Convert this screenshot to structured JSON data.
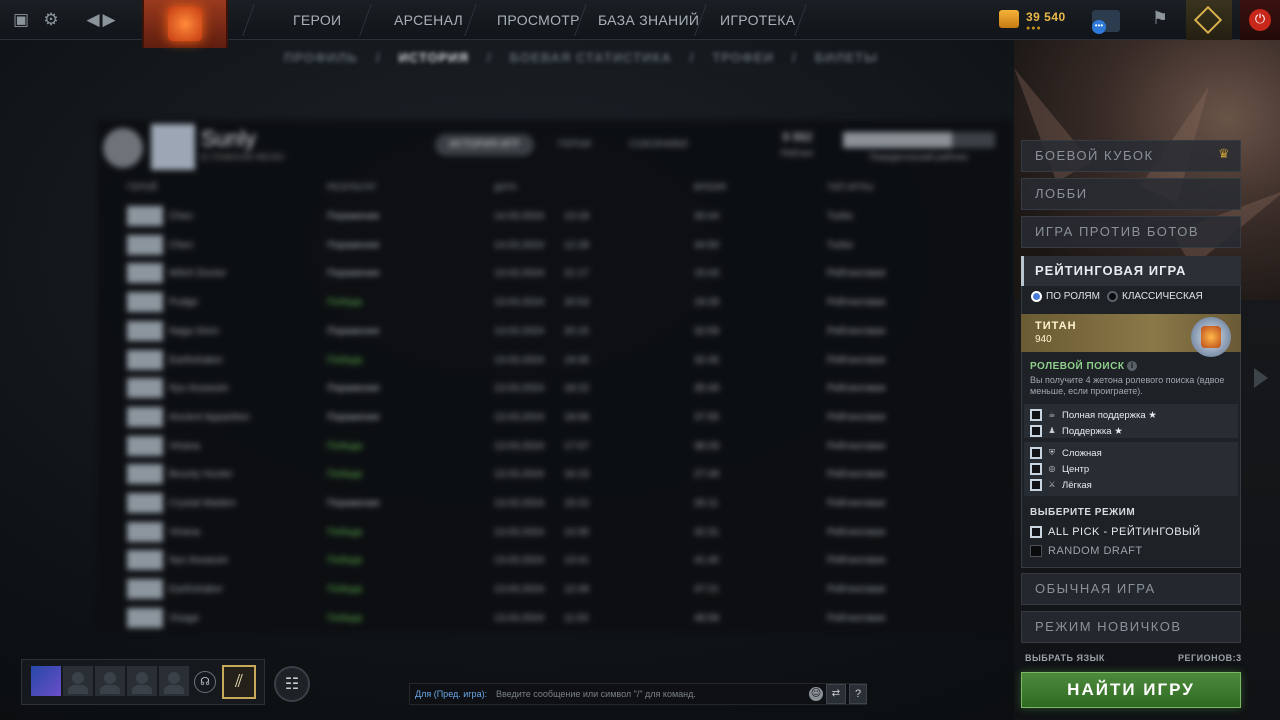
{
  "nav": {
    "items": [
      "ГЕРОИ",
      "АРСЕНАЛ",
      "ПРОСМОТР",
      "БАЗА ЗНАНИЙ",
      "ИГРОТЕКА"
    ],
    "gold": "39 540",
    "gold_dots": "●●●",
    "chat_badge": "•••"
  },
  "profile": {
    "subnav": [
      "ПРОФИЛЬ",
      "ИСТОРИЯ",
      "БОЕВАЯ СТАТИСТИКА",
      "ТРОФЕИ",
      "БИЛЕТЫ"
    ],
    "active_subnav": "ИСТОРИЯ",
    "name": "Sunly",
    "status": "В ГЛАВНОМ МЕНЮ",
    "tabs": [
      "ИСТОРИЯ ИГР",
      "ГЕРОИ",
      "СОЮЗНИКИ"
    ],
    "stat_value": "9 992",
    "stat_label": "Рейтинг",
    "bar_label": "Поведенческий рейтинг",
    "bar_fill": 0.72,
    "columns": [
      "ГЕРОЙ",
      "РЕЗУЛЬТАТ",
      "ДАТА",
      "ВРЕМЯ",
      "ТИП ИГРЫ"
    ],
    "rows": [
      {
        "hero": "Chen",
        "result": "Поражение",
        "win": false,
        "date": "14.03.2024",
        "time": "13:18",
        "duration": "33:44",
        "type": "Turbo"
      },
      {
        "hero": "Chen",
        "result": "Поражение",
        "win": false,
        "date": "14.03.2024",
        "time": "12:28",
        "duration": "34:50",
        "type": "Turbo"
      },
      {
        "hero": "Witch Doctor",
        "result": "Поражение",
        "win": false,
        "date": "13.03.2024",
        "time": "21:17",
        "duration": "15:43",
        "type": "Рейтинговая"
      },
      {
        "hero": "Pudge",
        "result": "Победа",
        "win": true,
        "date": "13.03.2024",
        "time": "20:53",
        "duration": "19:28",
        "type": "Рейтинговая"
      },
      {
        "hero": "Naga Siren",
        "result": "Поражение",
        "win": false,
        "date": "13.03.2024",
        "time": "20:15",
        "duration": "32:59",
        "type": "Рейтинговая"
      },
      {
        "hero": "Earthshaker",
        "result": "Победа",
        "win": true,
        "date": "13.03.2024",
        "time": "19:35",
        "duration": "32:45",
        "type": "Рейтинговая"
      },
      {
        "hero": "Nyx Assassin",
        "result": "Поражение",
        "win": false,
        "date": "13.03.2024",
        "time": "18:22",
        "duration": "35:49",
        "type": "Рейтинговая"
      },
      {
        "hero": "Ancient Apparition",
        "result": "Поражение",
        "win": false,
        "date": "13.03.2024",
        "time": "18:06",
        "duration": "37:55",
        "type": "Рейтинговая"
      },
      {
        "hero": "Viriana",
        "result": "Победа",
        "win": true,
        "date": "13.03.2024",
        "time": "17:07",
        "duration": "38:29",
        "type": "Рейтинговая"
      },
      {
        "hero": "Bounty Hunter",
        "result": "Победа",
        "win": true,
        "date": "13.03.2024",
        "time": "16:15",
        "duration": "27:49",
        "type": "Рейтинговая"
      },
      {
        "hero": "Crystal Maiden",
        "result": "Поражение",
        "win": false,
        "date": "13.03.2024",
        "time": "15:22",
        "duration": "26:11",
        "type": "Рейтинговая"
      },
      {
        "hero": "Viriana",
        "result": "Победа",
        "win": true,
        "date": "13.03.2024",
        "time": "14:30",
        "duration": "42:31",
        "type": "Рейтинговая"
      },
      {
        "hero": "Nyx Assassin",
        "result": "Победа",
        "win": true,
        "date": "13.03.2024",
        "time": "13:41",
        "duration": "41:40",
        "type": "Рейтинговая"
      },
      {
        "hero": "Earthshaker",
        "result": "Победа",
        "win": true,
        "date": "13.03.2024",
        "time": "12:49",
        "duration": "47:21",
        "type": "Рейтинговая"
      },
      {
        "hero": "Visage",
        "result": "Победа",
        "win": true,
        "date": "13.03.2024",
        "time": "11:53",
        "duration": "48:58",
        "type": "Рейтинговая"
      }
    ]
  },
  "play": {
    "battle_cup": "БОЕВОЙ КУБОК",
    "lobby": "ЛОББИ",
    "bots": "ИГРА ПРОТИВ БОТОВ",
    "ranked": "РЕЙТИНГОВАЯ ИГРА",
    "radio_roles": "ПО РОЛЯМ",
    "radio_classic": "КЛАССИЧЕСКАЯ",
    "rank_name": "ТИТАН",
    "rank_value": "940",
    "role_search": "РОЛЕВОЙ ПОИСК",
    "role_search_desc": "Вы получите 4 жетона ролевого поиска (вдвое меньше, если проиграете).",
    "roles_support": [
      "Полная поддержка ★",
      "Поддержка ★"
    ],
    "roles_core": [
      "Сложная",
      "Центр",
      "Лёгкая"
    ],
    "mode_title": "ВЫБЕРИТЕ РЕЖИМ",
    "modes": [
      "ALL PICK - РЕЙТИНГОВЫЙ",
      "RANDOM DRAFT"
    ],
    "normal": "ОБЫЧНАЯ ИГРА",
    "newbie": "РЕЖИМ НОВИЧКОВ",
    "lang": "ВЫБРАТЬ ЯЗЫК",
    "regions": "РЕГИОНОВ:3",
    "find": "НАЙТИ ИГРУ"
  },
  "chat": {
    "prefix": "Для (Пред. игра):",
    "placeholder": "Введите сообщение или символ \"/\" для команд.",
    "help": "?"
  }
}
